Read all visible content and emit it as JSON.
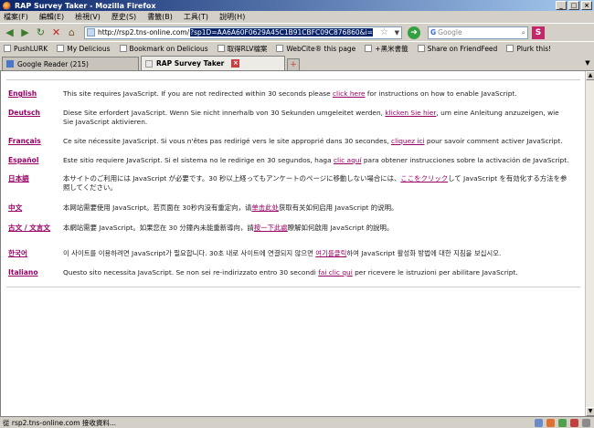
{
  "window": {
    "title": "RAP Survey Taker - Mozilla Firefox",
    "controls": {
      "minimize": "_",
      "maximize": "□",
      "close": "×"
    }
  },
  "menu": [
    "檔案(F)",
    "編輯(E)",
    "檢視(V)",
    "歷史(S)",
    "書籤(B)",
    "工具(T)",
    "說明(H)"
  ],
  "nav": {
    "url_prefix": "http://rsp2.tns-online.com/",
    "url_selected": "?sp1D=AA6A60F0629A45C1B91CBFC09C876860&i=",
    "search_placeholder": "Google",
    "search_engine_icon": "G",
    "search_button": "S"
  },
  "bookmarks": [
    "PushLURK",
    "My Delicious",
    "Bookmark on Delicious",
    "取得RLV檔案",
    "WebCite® this page",
    "+黑米書籤",
    "Share on FriendFeed",
    "Plurk this!"
  ],
  "tabs": [
    {
      "label": "Google Reader (215)",
      "active": false
    },
    {
      "label": "RAP Survey Taker",
      "active": true
    }
  ],
  "languages": [
    {
      "name": "English",
      "before": "This site requires JavaScript. If you are not redirected within 30 seconds please ",
      "link": "click here",
      "after": " for instructions on how to enable JavaScript."
    },
    {
      "name": "Deutsch",
      "before": "Diese Site erfordert JavaScript. Wenn Sie nicht innerhalb von 30 Sekunden umgeleitet werden, ",
      "link": "klicken Sie hier",
      "after": ", um eine Anleitung anzuzeigen, wie Sie JavaScript aktivieren."
    },
    {
      "name": "Français",
      "before": "Ce site nécessite JavaScript. Si vous n'êtes pas redirigé vers le site approprié dans 30 secondes, ",
      "link": "cliquez ici",
      "after": " pour savoir comment activer JavaScript."
    },
    {
      "name": "Español",
      "before": "Este sitio requiere JavaScript. Si el sistema no le redirige en 30 segundos, haga ",
      "link": "clic aquí",
      "after": " para obtener instrucciones sobre la activación de JavaScript."
    },
    {
      "name": "日本語",
      "before": "本サイトのご利用には JavaScript が必要です。30 秒以上経ってもアンケートのページに移動しない場合には、",
      "link": "ここをクリック",
      "after": "して JavaScript を有効化する方法を参照してください。"
    },
    {
      "name": "中文",
      "before": "本网站需要使用 JavaScript。若页面在 30秒内没有重定向，请",
      "link": "单击此处",
      "after": "获取有关如何启用 JavaScript 的说明。"
    },
    {
      "name": "古文 / 文言文",
      "before": "本網站需要 JavaScript。如果您在 30 分鐘內未能重新導向，請",
      "link": "按一下此處",
      "after": "瞭解如何啟用 JavaScript 的說明。"
    },
    {
      "name": "한국어",
      "before": "이 사이트를 이용하려면 JavaScript가 필요합니다. 30초 내로 사이트에 연결되지 않으면 ",
      "link": "여기를클릭",
      "after": "하여 JavaScript 활성화 방법에 대한 지침을 보십시오."
    },
    {
      "name": "Italiano",
      "before": "Questo sito necessita JavaScript. Se non sei re-indirizzato entro 30 secondi ",
      "link": "fai clic qui",
      "after": " per ricevere le istruzioni per abilitare JavaScript."
    }
  ],
  "status": {
    "text": "從 rsp2.tns-online.com 接收資料..."
  }
}
